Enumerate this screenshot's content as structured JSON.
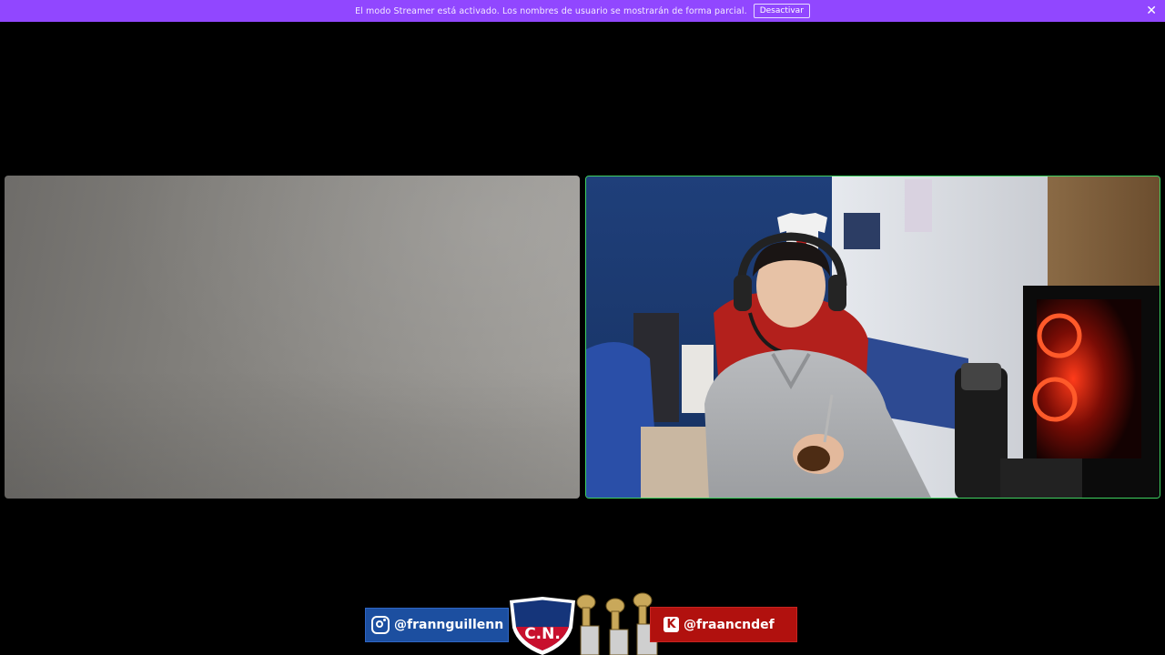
{
  "banner": {
    "text": "El modo Streamer está activado. Los nombres de usuario se mostrarán de forma parcial.",
    "button_label": "Desactivar",
    "close_glyph": "✕",
    "background_color": "#9147ff"
  },
  "tiles": {
    "active_speaker_border_color": "#3fd160"
  },
  "overlay": {
    "instagram": {
      "handle": "@frannguillenn",
      "icon": "instagram-icon",
      "color": "#1c4fa0"
    },
    "kick": {
      "handle": "@fraancndef",
      "icon_letter": "K",
      "icon": "kick-icon",
      "color": "#b1110e"
    },
    "crest_text": "C.N.de F."
  }
}
